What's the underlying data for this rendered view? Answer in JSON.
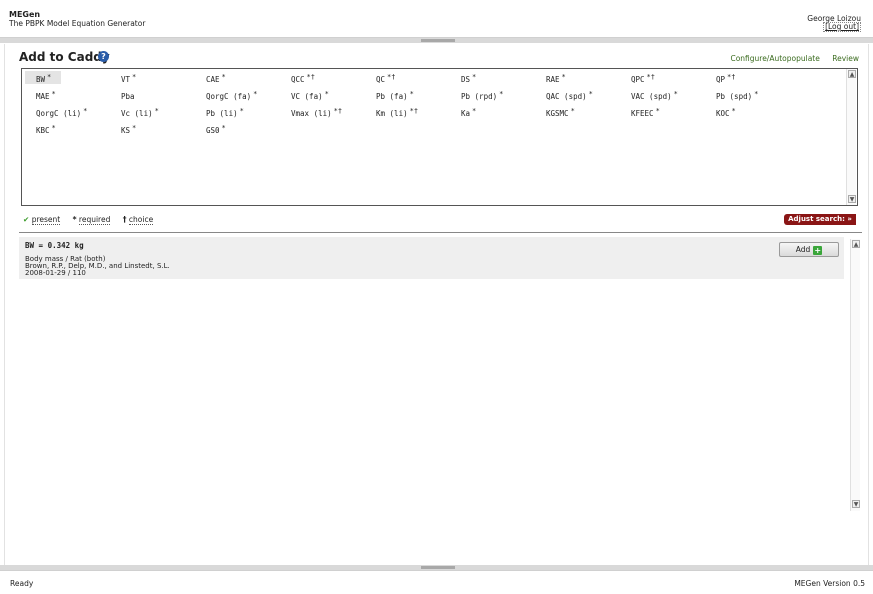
{
  "header": {
    "app_name": "MEGen",
    "subtitle": "The PBPK Model Equation Generator",
    "user_name": "George Loizou",
    "logout": "[Log out]"
  },
  "page": {
    "title": "Add to Caddy",
    "help_icon": "?",
    "links": [
      "Configure/Autopopulate",
      "Review"
    ]
  },
  "variables": [
    {
      "name": "BW",
      "mark": "*"
    },
    {
      "name": "VT",
      "mark": "*"
    },
    {
      "name": "CAE",
      "mark": "*"
    },
    {
      "name": "QCC",
      "mark": "*†"
    },
    {
      "name": "QC",
      "mark": "*†"
    },
    {
      "name": "DS",
      "mark": "*"
    },
    {
      "name": "RAE",
      "mark": "*"
    },
    {
      "name": "QPC",
      "mark": "*†"
    },
    {
      "name": "QP",
      "mark": "*†"
    },
    {
      "name": "MAE",
      "mark": "*"
    },
    {
      "name": "Pba",
      "mark": ""
    },
    {
      "name": "QorgC (fa)",
      "mark": "*"
    },
    {
      "name": "VC (fa)",
      "mark": "*"
    },
    {
      "name": "Pb (fa)",
      "mark": "*"
    },
    {
      "name": "Pb (rpd)",
      "mark": "*"
    },
    {
      "name": "QAC (spd)",
      "mark": "*"
    },
    {
      "name": "VAC (spd)",
      "mark": "*"
    },
    {
      "name": "Pb (spd)",
      "mark": "*"
    },
    {
      "name": "QorgC (li)",
      "mark": "*"
    },
    {
      "name": "Vc (li)",
      "mark": "*"
    },
    {
      "name": "Pb (li)",
      "mark": "*"
    },
    {
      "name": "Vmax (li)",
      "mark": "*†"
    },
    {
      "name": "Km (li)",
      "mark": "*†"
    },
    {
      "name": "Ka",
      "mark": "*"
    },
    {
      "name": "KGSMC",
      "mark": "*"
    },
    {
      "name": "KFEEC",
      "mark": "*"
    },
    {
      "name": "KOC",
      "mark": "*"
    },
    {
      "name": "KBC",
      "mark": "*"
    },
    {
      "name": "KS",
      "mark": "*"
    },
    {
      "name": "GS0",
      "mark": "*"
    }
  ],
  "legend": {
    "present_symbol": "✔",
    "present": "present",
    "required_symbol": "*",
    "required": "required",
    "choice_symbol": "†",
    "choice": "choice"
  },
  "adjust_search": "Adjust search: »",
  "result": {
    "title": "BW = 0.342 kg",
    "line1": "Body mass / Rat (both)",
    "line2": "Brown, R.P., Delp, M.D., and Linstedt, S.L.",
    "line3": "2008-01-29 / 110",
    "add_label": "Add",
    "add_icon": "+"
  },
  "footer": {
    "status": "Ready",
    "version": "MEGen Version 0.5"
  },
  "colors": {
    "accent_green": "#3a6b1e",
    "adjust_red": "#8a1515",
    "help_blue": "#2b5da8"
  }
}
